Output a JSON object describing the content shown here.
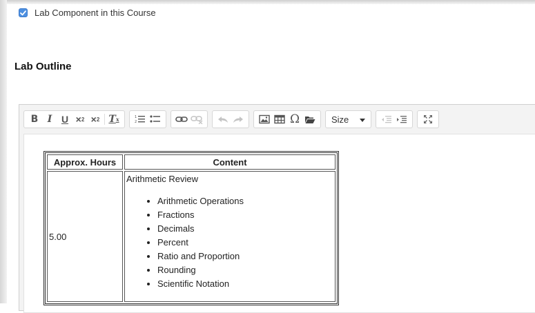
{
  "lab_component": {
    "label": "Lab Component in this Course",
    "checked": true
  },
  "section": {
    "title": "Lab Outline"
  },
  "toolbar": {
    "groups": [
      [
        "bold-icon",
        "italic-icon",
        "underline-icon",
        "subscript-icon",
        "superscript-icon",
        "remove-format-icon"
      ],
      [
        "numbered-list-icon",
        "bulleted-list-icon"
      ],
      [
        "link-icon",
        "unlink-icon"
      ],
      [
        "undo-icon",
        "redo-icon"
      ],
      [
        "image-icon",
        "table-icon",
        "special-character-icon",
        "browse-files-icon"
      ],
      [
        "size-dropdown"
      ],
      [
        "decrease-indent-icon",
        "increase-indent-icon"
      ],
      [
        "maximize-icon"
      ]
    ],
    "size_label": "Size"
  },
  "table": {
    "headers": {
      "hours": "Approx. Hours",
      "content": "Content"
    },
    "rows": [
      {
        "hours": "5.00",
        "title": "Arithmetic Review",
        "topics": [
          "Arithmetic Operations",
          "Fractions",
          "Decimals",
          "Percent",
          "Ratio and Proportion",
          "Rounding",
          "Scientific Notation"
        ]
      }
    ]
  }
}
